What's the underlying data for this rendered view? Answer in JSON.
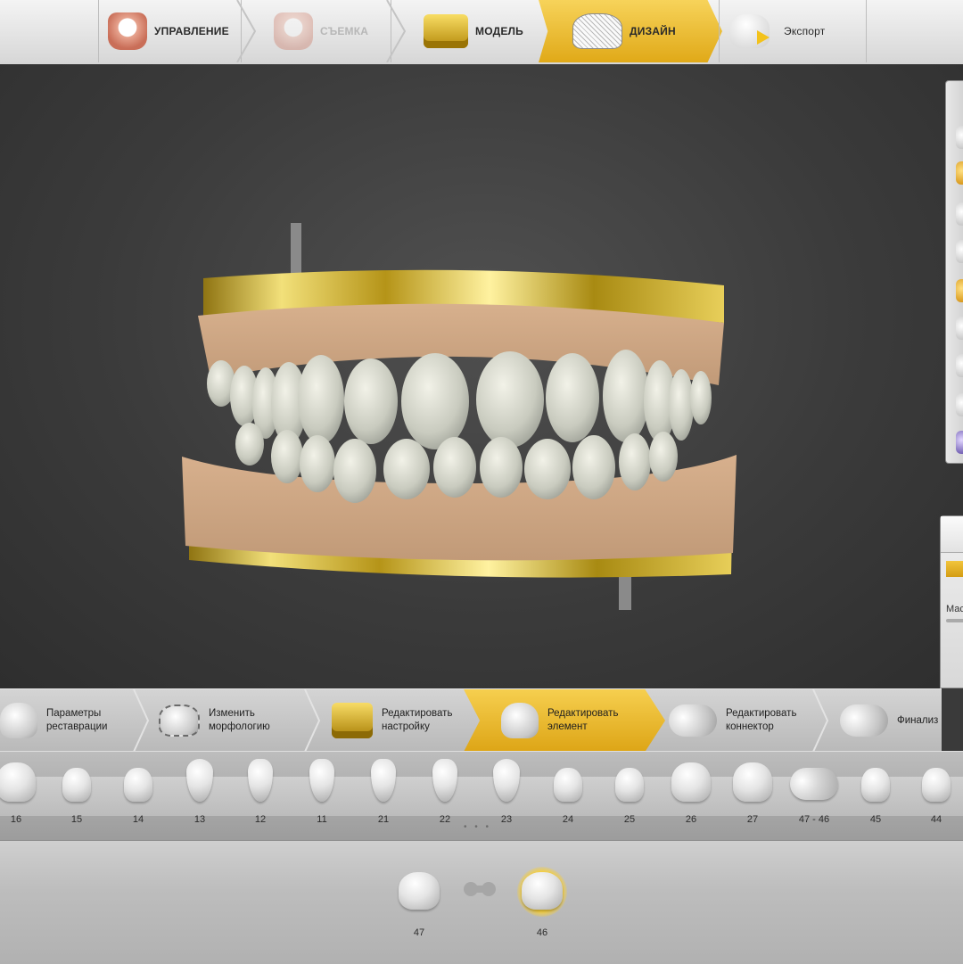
{
  "workflow": {
    "steps": [
      {
        "label": "УПРАВЛЕНИЕ",
        "icon": "jaw-icon",
        "state": "normal"
      },
      {
        "label": "СЪЕМКА",
        "icon": "jaw-scan-icon",
        "state": "disabled"
      },
      {
        "label": "МОДЕЛЬ",
        "icon": "model-icon",
        "state": "normal"
      },
      {
        "label": "ДИЗАЙН",
        "icon": "design-icon",
        "state": "active"
      },
      {
        "label": "Экспорт",
        "icon": "export-icon",
        "state": "normal"
      }
    ]
  },
  "design_steps": {
    "items": [
      {
        "label": "Параметры\nреставрации",
        "icon": "restoration-params-icon",
        "state": "normal"
      },
      {
        "label": "Изменить\nморфологию",
        "icon": "morphology-icon",
        "state": "normal"
      },
      {
        "label": "Редактировать\nнастройку",
        "icon": "setup-icon",
        "state": "normal"
      },
      {
        "label": "Редактировать\nэлемент",
        "icon": "edit-element-icon",
        "state": "active"
      },
      {
        "label": "Редактировать\nконнектор",
        "icon": "connector-icon",
        "state": "normal"
      },
      {
        "label": "Финализ",
        "icon": "finalize-icon",
        "state": "normal"
      }
    ]
  },
  "teeth_strip": {
    "teeth": [
      {
        "label": "16",
        "type": "molar"
      },
      {
        "label": "15",
        "type": "premolar"
      },
      {
        "label": "14",
        "type": "premolar"
      },
      {
        "label": "13",
        "type": "canine"
      },
      {
        "label": "12",
        "type": "incisor"
      },
      {
        "label": "11",
        "type": "incisor"
      },
      {
        "label": "21",
        "type": "incisor"
      },
      {
        "label": "22",
        "type": "incisor"
      },
      {
        "label": "23",
        "type": "canine"
      },
      {
        "label": "24",
        "type": "premolar"
      },
      {
        "label": "25",
        "type": "premolar"
      },
      {
        "label": "26",
        "type": "molar"
      },
      {
        "label": "27",
        "type": "molar"
      },
      {
        "label": "47 - 46",
        "type": "bridge"
      },
      {
        "label": "45",
        "type": "premolar"
      },
      {
        "label": "44",
        "type": "premolar"
      }
    ],
    "pager": "• • •"
  },
  "elements": {
    "items": [
      {
        "label": "47",
        "selected": false
      },
      {
        "label": "46",
        "selected": true
      }
    ]
  },
  "side_panel": {
    "param_label": "Мас"
  },
  "colors": {
    "accent_gold": "#e6b325",
    "viewport_bg": "#3c3c3c",
    "toolbar_bg": "#e0e0e0"
  }
}
